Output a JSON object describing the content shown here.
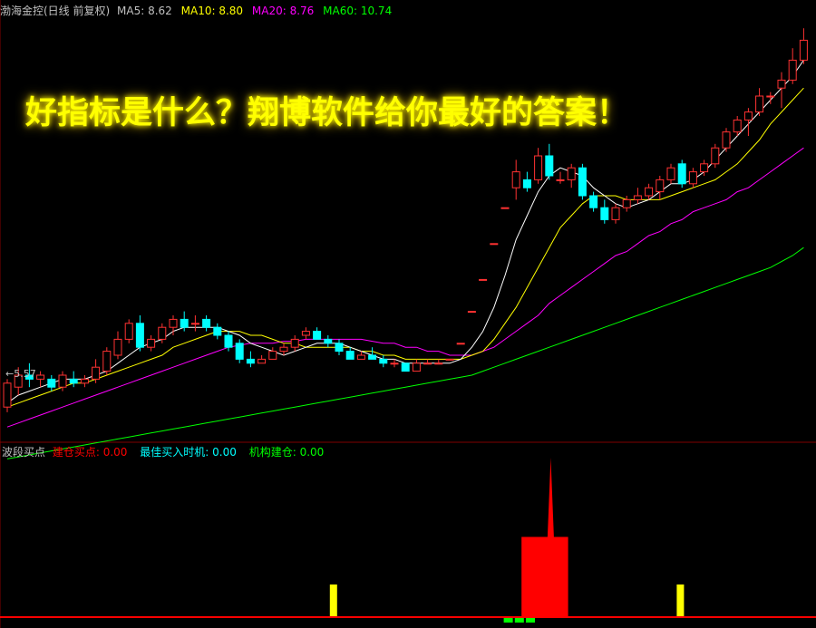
{
  "header": {
    "title": "渤海金控(日线 前复权)",
    "ma5_label": "MA5:",
    "ma5": "8.62",
    "ma10_label": "MA10:",
    "ma10": "8.80",
    "ma20_label": "MA20:",
    "ma20": "8.76",
    "ma60_label": "MA60:",
    "ma60": "10.74"
  },
  "promo_text": "好指标是什么？翔博软件给你最好的答案！",
  "low_marker": "5.57",
  "indicator": {
    "name": "波段买点",
    "s1_label": "建仓买点:",
    "s1_value": "0.00",
    "s2_label": "最佳买入时机:",
    "s2_value": "0.00",
    "s3_label": "机构建仓:",
    "s3_value": "0.00"
  },
  "colors": {
    "up": "#ff3232",
    "down": "#00ffff",
    "ma5": "#ffffff",
    "ma10": "#ffff00",
    "ma20": "#ff00ff",
    "ma60": "#00ff00",
    "signal_red": "#ff0000",
    "signal_yellow": "#ffff00",
    "signal_green": "#00ff00",
    "divider": "#800000"
  },
  "chart_data": [
    {
      "type": "candlestick",
      "ylim": [
        5.0,
        15.5
      ],
      "candles": [
        {
          "o": 5.7,
          "h": 6.4,
          "l": 5.57,
          "c": 6.3
        },
        {
          "o": 6.2,
          "h": 6.7,
          "l": 6.0,
          "c": 6.5
        },
        {
          "o": 6.5,
          "h": 6.8,
          "l": 6.2,
          "c": 6.4
        },
        {
          "o": 6.4,
          "h": 6.6,
          "l": 6.2,
          "c": 6.5
        },
        {
          "o": 6.4,
          "h": 6.5,
          "l": 6.1,
          "c": 6.2
        },
        {
          "o": 6.2,
          "h": 6.6,
          "l": 6.1,
          "c": 6.5
        },
        {
          "o": 6.4,
          "h": 6.6,
          "l": 6.2,
          "c": 6.3
        },
        {
          "o": 6.3,
          "h": 6.5,
          "l": 6.2,
          "c": 6.4
        },
        {
          "o": 6.4,
          "h": 6.9,
          "l": 6.3,
          "c": 6.7
        },
        {
          "o": 6.6,
          "h": 7.2,
          "l": 6.5,
          "c": 7.1
        },
        {
          "o": 7.0,
          "h": 7.6,
          "l": 6.9,
          "c": 7.4
        },
        {
          "o": 7.4,
          "h": 7.9,
          "l": 7.3,
          "c": 7.8
        },
        {
          "o": 7.8,
          "h": 8.0,
          "l": 7.1,
          "c": 7.2
        },
        {
          "o": 7.2,
          "h": 7.5,
          "l": 7.1,
          "c": 7.4
        },
        {
          "o": 7.4,
          "h": 7.8,
          "l": 7.3,
          "c": 7.7
        },
        {
          "o": 7.7,
          "h": 8.0,
          "l": 7.5,
          "c": 7.9
        },
        {
          "o": 7.9,
          "h": 8.1,
          "l": 7.6,
          "c": 7.7
        },
        {
          "o": 7.8,
          "h": 8.0,
          "l": 7.6,
          "c": 7.8
        },
        {
          "o": 7.9,
          "h": 8.0,
          "l": 7.6,
          "c": 7.7
        },
        {
          "o": 7.7,
          "h": 7.8,
          "l": 7.4,
          "c": 7.5
        },
        {
          "o": 7.5,
          "h": 7.6,
          "l": 7.1,
          "c": 7.2
        },
        {
          "o": 7.3,
          "h": 7.4,
          "l": 6.8,
          "c": 6.9
        },
        {
          "o": 6.9,
          "h": 7.1,
          "l": 6.7,
          "c": 6.8
        },
        {
          "o": 6.8,
          "h": 7.0,
          "l": 6.8,
          "c": 6.9
        },
        {
          "o": 6.9,
          "h": 7.2,
          "l": 6.9,
          "c": 7.1
        },
        {
          "o": 7.1,
          "h": 7.3,
          "l": 7.0,
          "c": 7.2
        },
        {
          "o": 7.2,
          "h": 7.5,
          "l": 7.1,
          "c": 7.4
        },
        {
          "o": 7.5,
          "h": 7.7,
          "l": 7.4,
          "c": 7.6
        },
        {
          "o": 7.6,
          "h": 7.7,
          "l": 7.4,
          "c": 7.4
        },
        {
          "o": 7.4,
          "h": 7.5,
          "l": 7.2,
          "c": 7.3
        },
        {
          "o": 7.3,
          "h": 7.4,
          "l": 7.0,
          "c": 7.1
        },
        {
          "o": 7.1,
          "h": 7.2,
          "l": 6.9,
          "c": 6.9
        },
        {
          "o": 6.9,
          "h": 7.1,
          "l": 6.9,
          "c": 7.0
        },
        {
          "o": 7.0,
          "h": 7.2,
          "l": 6.9,
          "c": 6.9
        },
        {
          "o": 6.9,
          "h": 7.0,
          "l": 6.7,
          "c": 6.8
        },
        {
          "o": 6.8,
          "h": 6.9,
          "l": 6.7,
          "c": 6.8
        },
        {
          "o": 6.8,
          "h": 6.8,
          "l": 6.6,
          "c": 6.6
        },
        {
          "o": 6.6,
          "h": 6.9,
          "l": 6.6,
          "c": 6.8
        },
        {
          "o": 6.8,
          "h": 6.9,
          "l": 6.8,
          "c": 6.8
        },
        {
          "o": 6.8,
          "h": 6.9,
          "l": 6.8,
          "c": 6.8
        },
        {
          "o": 6.9,
          "h": 6.9,
          "l": 6.9,
          "c": 6.9
        },
        {
          "o": 7.3,
          "h": 7.3,
          "l": 7.3,
          "c": 7.3
        },
        {
          "o": 8.1,
          "h": 8.1,
          "l": 8.1,
          "c": 8.1
        },
        {
          "o": 8.9,
          "h": 8.9,
          "l": 8.9,
          "c": 8.9
        },
        {
          "o": 9.8,
          "h": 9.8,
          "l": 9.8,
          "c": 9.8
        },
        {
          "o": 10.7,
          "h": 10.7,
          "l": 10.7,
          "c": 10.7
        },
        {
          "o": 11.2,
          "h": 11.9,
          "l": 10.9,
          "c": 11.6
        },
        {
          "o": 11.4,
          "h": 11.6,
          "l": 11.1,
          "c": 11.2
        },
        {
          "o": 11.4,
          "h": 12.2,
          "l": 11.3,
          "c": 12.0
        },
        {
          "o": 12.0,
          "h": 12.3,
          "l": 11.4,
          "c": 11.5
        },
        {
          "o": 11.4,
          "h": 11.6,
          "l": 11.3,
          "c": 11.4
        },
        {
          "o": 11.4,
          "h": 11.8,
          "l": 11.2,
          "c": 11.7
        },
        {
          "o": 11.7,
          "h": 11.8,
          "l": 10.9,
          "c": 11.0
        },
        {
          "o": 11.0,
          "h": 11.1,
          "l": 10.6,
          "c": 10.7
        },
        {
          "o": 10.7,
          "h": 10.9,
          "l": 10.3,
          "c": 10.4
        },
        {
          "o": 10.4,
          "h": 10.8,
          "l": 10.3,
          "c": 10.7
        },
        {
          "o": 10.7,
          "h": 11.0,
          "l": 10.6,
          "c": 10.9
        },
        {
          "o": 10.9,
          "h": 11.2,
          "l": 10.8,
          "c": 11.0
        },
        {
          "o": 11.0,
          "h": 11.3,
          "l": 10.9,
          "c": 11.2
        },
        {
          "o": 11.1,
          "h": 11.5,
          "l": 10.9,
          "c": 11.4
        },
        {
          "o": 11.4,
          "h": 11.8,
          "l": 11.3,
          "c": 11.7
        },
        {
          "o": 11.8,
          "h": 11.9,
          "l": 11.2,
          "c": 11.3
        },
        {
          "o": 11.3,
          "h": 11.7,
          "l": 11.2,
          "c": 11.6
        },
        {
          "o": 11.6,
          "h": 11.9,
          "l": 11.5,
          "c": 11.8
        },
        {
          "o": 11.8,
          "h": 12.3,
          "l": 11.7,
          "c": 12.2
        },
        {
          "o": 12.2,
          "h": 12.7,
          "l": 12.1,
          "c": 12.6
        },
        {
          "o": 12.6,
          "h": 13.0,
          "l": 12.5,
          "c": 12.9
        },
        {
          "o": 12.9,
          "h": 13.2,
          "l": 12.5,
          "c": 13.1
        },
        {
          "o": 13.1,
          "h": 13.7,
          "l": 13.0,
          "c": 13.5
        },
        {
          "o": 13.5,
          "h": 13.6,
          "l": 13.3,
          "c": 13.5
        },
        {
          "o": 13.7,
          "h": 14.1,
          "l": 13.2,
          "c": 13.9
        },
        {
          "o": 13.9,
          "h": 14.7,
          "l": 13.8,
          "c": 14.4
        },
        {
          "o": 14.4,
          "h": 15.2,
          "l": 14.3,
          "c": 14.9
        }
      ],
      "ma5": [
        5.8,
        6.0,
        6.1,
        6.2,
        6.3,
        6.4,
        6.4,
        6.4,
        6.5,
        6.6,
        6.8,
        7.0,
        7.2,
        7.3,
        7.4,
        7.6,
        7.7,
        7.7,
        7.7,
        7.7,
        7.6,
        7.5,
        7.3,
        7.2,
        7.1,
        7.0,
        7.1,
        7.2,
        7.3,
        7.3,
        7.3,
        7.2,
        7.1,
        7.0,
        6.9,
        6.9,
        6.8,
        6.8,
        6.8,
        6.8,
        6.8,
        6.9,
        7.2,
        7.6,
        8.2,
        9.0,
        9.9,
        10.5,
        11.1,
        11.5,
        11.7,
        11.6,
        11.5,
        11.2,
        11.0,
        10.8,
        10.7,
        10.8,
        10.9,
        11.1,
        11.3,
        11.3,
        11.4,
        11.6,
        11.9,
        12.2,
        12.5,
        12.8,
        13.1,
        13.4,
        13.7,
        14.0,
        14.4
      ],
      "ma10": [
        5.7,
        5.8,
        5.9,
        6.0,
        6.1,
        6.2,
        6.3,
        6.3,
        6.4,
        6.5,
        6.6,
        6.7,
        6.8,
        6.9,
        7.0,
        7.2,
        7.3,
        7.4,
        7.5,
        7.6,
        7.6,
        7.6,
        7.5,
        7.5,
        7.4,
        7.3,
        7.3,
        7.2,
        7.2,
        7.2,
        7.2,
        7.2,
        7.1,
        7.1,
        7.0,
        7.0,
        6.9,
        6.9,
        6.9,
        6.9,
        6.9,
        6.9,
        7.0,
        7.1,
        7.4,
        7.8,
        8.2,
        8.7,
        9.2,
        9.7,
        10.2,
        10.5,
        10.8,
        11.0,
        11.0,
        11.0,
        10.9,
        10.9,
        10.9,
        10.9,
        11.0,
        11.1,
        11.2,
        11.3,
        11.4,
        11.6,
        11.8,
        12.1,
        12.4,
        12.8,
        13.1,
        13.4,
        13.7
      ],
      "ma20": [
        5.2,
        5.3,
        5.4,
        5.5,
        5.6,
        5.7,
        5.8,
        5.9,
        6.0,
        6.1,
        6.2,
        6.3,
        6.4,
        6.5,
        6.6,
        6.7,
        6.8,
        6.9,
        7.0,
        7.1,
        7.2,
        7.25,
        7.3,
        7.3,
        7.3,
        7.35,
        7.35,
        7.4,
        7.4,
        7.4,
        7.4,
        7.4,
        7.4,
        7.35,
        7.3,
        7.3,
        7.2,
        7.2,
        7.1,
        7.1,
        7.0,
        7.0,
        7.0,
        7.1,
        7.2,
        7.4,
        7.6,
        7.8,
        8.0,
        8.3,
        8.5,
        8.7,
        8.9,
        9.1,
        9.3,
        9.5,
        9.6,
        9.8,
        10.0,
        10.1,
        10.3,
        10.4,
        10.6,
        10.7,
        10.8,
        10.9,
        11.1,
        11.2,
        11.4,
        11.6,
        11.8,
        12.0,
        12.2
      ],
      "ma60": [
        4.4,
        4.45,
        4.5,
        4.55,
        4.6,
        4.65,
        4.7,
        4.75,
        4.8,
        4.85,
        4.9,
        4.95,
        5.0,
        5.05,
        5.1,
        5.15,
        5.2,
        5.25,
        5.3,
        5.35,
        5.4,
        5.45,
        5.5,
        5.55,
        5.6,
        5.65,
        5.7,
        5.75,
        5.8,
        5.85,
        5.9,
        5.95,
        6.0,
        6.05,
        6.1,
        6.15,
        6.2,
        6.25,
        6.3,
        6.35,
        6.4,
        6.45,
        6.5,
        6.6,
        6.7,
        6.8,
        6.9,
        7.0,
        7.1,
        7.2,
        7.3,
        7.4,
        7.5,
        7.6,
        7.7,
        7.8,
        7.9,
        8.0,
        8.1,
        8.2,
        8.3,
        8.4,
        8.5,
        8.6,
        8.7,
        8.8,
        8.9,
        9.0,
        9.1,
        9.2,
        9.35,
        9.5,
        9.7
      ]
    },
    {
      "type": "bar",
      "title": "波段买点",
      "ylim": [
        0,
        100
      ],
      "signals": [
        {
          "series": "yellow",
          "index": 24,
          "value": 20
        },
        {
          "series": "yellow",
          "index": 37,
          "value": 20
        },
        {
          "series": "yellow",
          "index": 57,
          "value": 20
        },
        {
          "series": "red",
          "index": 36,
          "value": 50
        },
        {
          "series": "red",
          "index": 37,
          "value": 100
        },
        {
          "series": "red",
          "index": 38,
          "value": 50
        },
        {
          "series": "green",
          "index": 33,
          "value": 3
        },
        {
          "series": "green",
          "index": 34,
          "value": 3
        },
        {
          "series": "green",
          "index": 35,
          "value": 3
        }
      ]
    }
  ]
}
